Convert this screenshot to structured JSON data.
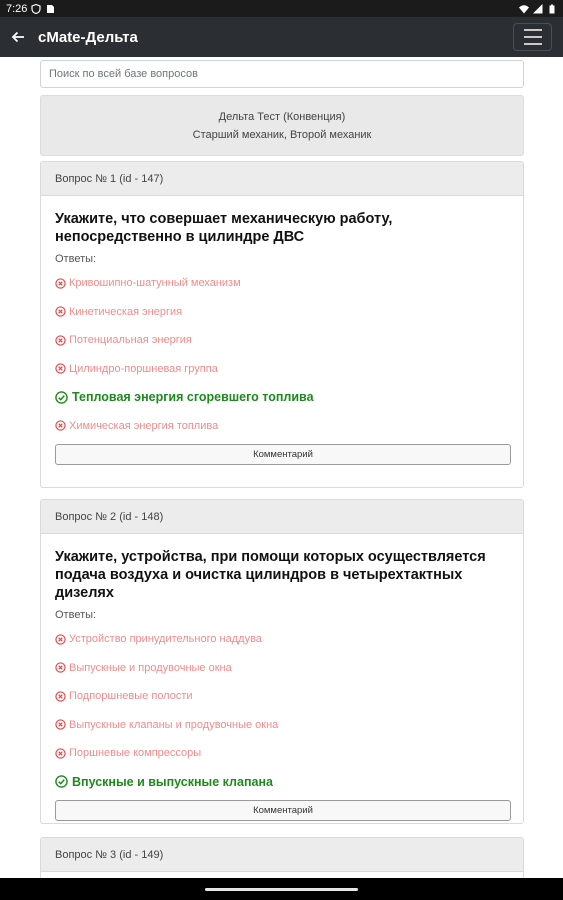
{
  "status_bar": {
    "time": "7:26",
    "left_icons": [
      "shield-icon",
      "sim-icon"
    ],
    "right_icons": [
      "wifi-icon",
      "signal-icon",
      "battery-icon"
    ]
  },
  "app_bar": {
    "title": "cMate-Дельта",
    "background": "#2b2e33"
  },
  "search": {
    "placeholder": "Поиск по всей базе вопросов"
  },
  "test_info": {
    "title": "Дельта Тест (Конвенция)",
    "positions": "Старший механик, Второй механик"
  },
  "colors": {
    "wrong": "#ef8c8c",
    "correct": "#1e8a1e"
  },
  "questions": [
    {
      "header": "Вопрос № 1 (id - 147)",
      "text": "Укажите, что совершает механическую работу, непосредственно в цилиндре ДВС",
      "answers_label": "Ответы:",
      "answers": [
        {
          "text": "Кривошипно-шатунный механизм",
          "correct": false
        },
        {
          "text": "Кинетическая энергия",
          "correct": false
        },
        {
          "text": "Потенциальная энергия",
          "correct": false
        },
        {
          "text": "Цилиндро-поршневая группа",
          "correct": false
        },
        {
          "text": "Тепловая энергия сгоревшего топлива",
          "correct": true
        },
        {
          "text": "Химическая энергия топлива",
          "correct": false
        }
      ],
      "comment_button": "Комментарий"
    },
    {
      "header": "Вопрос № 2 (id - 148)",
      "text": "Укажите, устройства, при помощи которых осуществляется подача воздуха и очистка цилиндров в четырехтактных дизелях",
      "answers_label": "Ответы:",
      "answers": [
        {
          "text": "Устройство принудительного наддува",
          "correct": false
        },
        {
          "text": "Выпускные и продувочные окна",
          "correct": false
        },
        {
          "text": "Подпоршневые полости",
          "correct": false
        },
        {
          "text": "Выпускные клапаны и продувочные окна",
          "correct": false
        },
        {
          "text": "Поршневые компрессоры",
          "correct": false
        },
        {
          "text": "Впускные и выпускные клапана",
          "correct": true
        }
      ],
      "comment_button": "Комментарий"
    },
    {
      "header": "Вопрос № 3 (id - 149)"
    }
  ]
}
